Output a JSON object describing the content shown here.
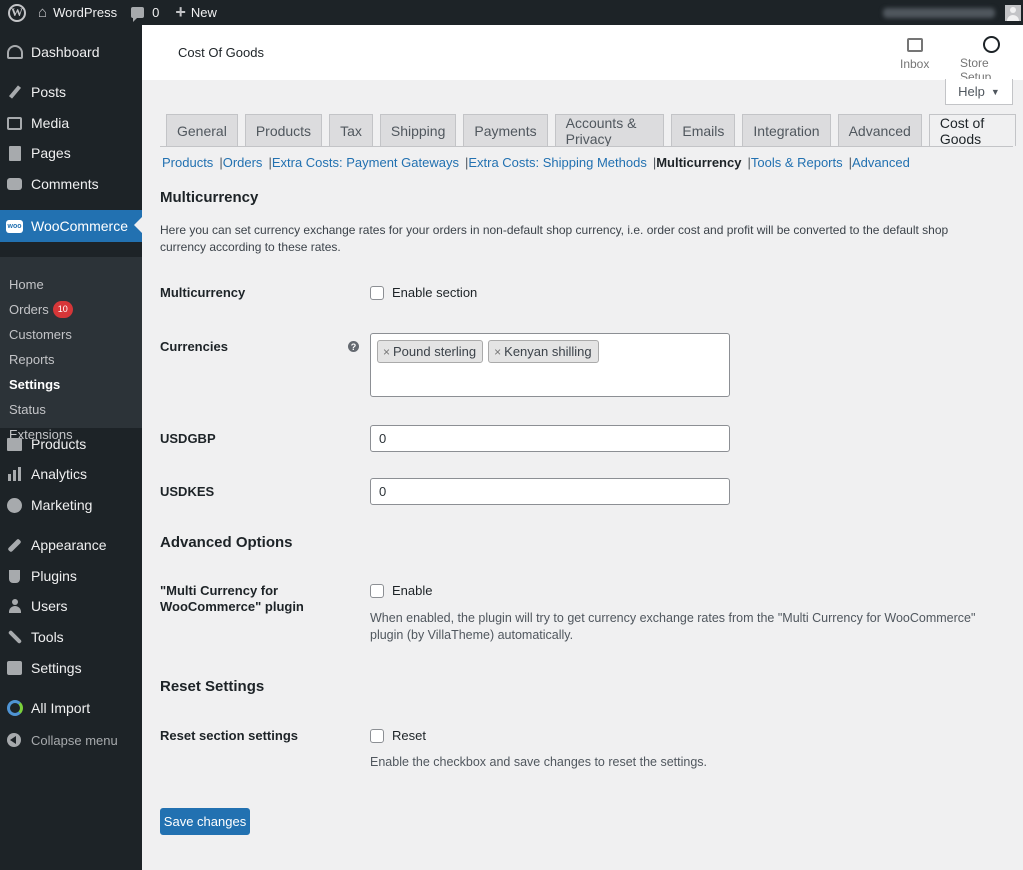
{
  "adminbar": {
    "site_name": "WordPress",
    "comments_count": "0",
    "new_label": "New"
  },
  "sidebar": {
    "dashboard": "Dashboard",
    "posts": "Posts",
    "media": "Media",
    "pages": "Pages",
    "comments": "Comments",
    "woocommerce": "WooCommerce",
    "woo_logo_text": "woo",
    "submenu": {
      "home": "Home",
      "orders": "Orders",
      "orders_badge": "10",
      "customers": "Customers",
      "reports": "Reports",
      "settings": "Settings",
      "status": "Status",
      "extensions": "Extensions"
    },
    "products": "Products",
    "analytics": "Analytics",
    "marketing": "Marketing",
    "appearance": "Appearance",
    "plugins": "Plugins",
    "users": "Users",
    "tools": "Tools",
    "settings": "Settings",
    "all_import": "All Import",
    "collapse": "Collapse menu"
  },
  "header": {
    "title": "Cost Of Goods",
    "inbox": "Inbox",
    "store_setup": "Store Setup",
    "help": "Help"
  },
  "tabs": [
    "General",
    "Products",
    "Tax",
    "Shipping",
    "Payments",
    "Accounts & Privacy",
    "Emails",
    "Integration",
    "Advanced",
    "Cost of Goods"
  ],
  "subsections": {
    "products": "Products",
    "orders": "Orders",
    "extra_payment": "Extra Costs: Payment Gateways",
    "extra_shipping": "Extra Costs: Shipping Methods",
    "multicurrency": "Multicurrency",
    "tools_reports": "Tools & Reports",
    "advanced": "Advanced",
    "separator": "|"
  },
  "main": {
    "section_title": "Multicurrency",
    "section_desc": "Here you can set currency exchange rates for your orders in non-default shop currency, i.e. order cost and profit will be converted to the default shop currency according to these rates.",
    "multicurrency_label": "Multicurrency",
    "enable_section": "Enable section",
    "currencies_label": "Currencies",
    "help_tip": "?",
    "currency_chips": [
      "Pound sterling",
      "Kenyan shilling"
    ],
    "chip_remove": "×",
    "usdgbp_label": "USDGBP",
    "usdgbp_value": "0",
    "usdkes_label": "USDKES",
    "usdkes_value": "0",
    "advanced_title": "Advanced Options",
    "mcw_label": "\"Multi Currency for WooCommerce\" plugin",
    "enable": "Enable",
    "mcw_desc": "When enabled, the plugin will try to get currency exchange rates from the \"Multi Currency for WooCommerce\" plugin (by VillaTheme) automatically.",
    "reset_title": "Reset Settings",
    "reset_label": "Reset section settings",
    "reset": "Reset",
    "reset_desc": "Enable the checkbox and save changes to reset the settings.",
    "save": "Save changes"
  }
}
